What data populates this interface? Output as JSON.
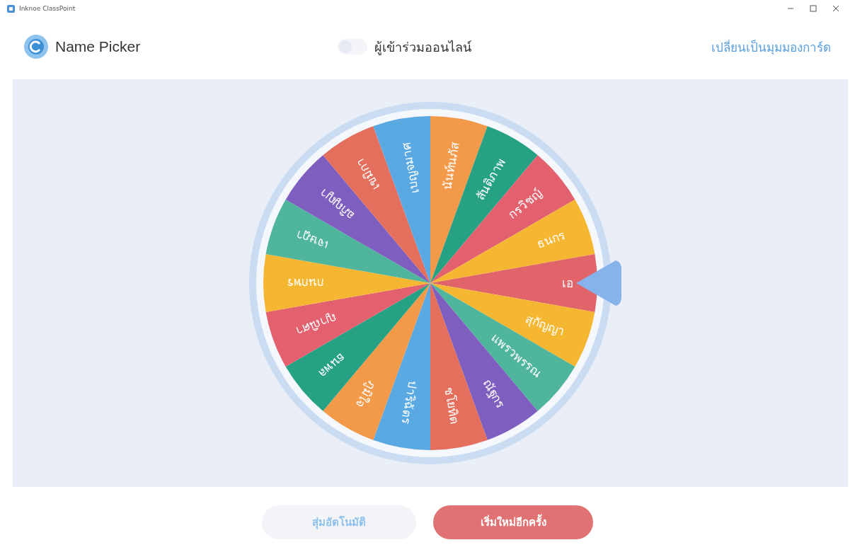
{
  "window": {
    "title": "Inknoe ClassPoint"
  },
  "header": {
    "title": "Name Picker",
    "toggle": {
      "label": "ผู้เข้าร่วมออนไลน์",
      "on": false
    },
    "link": "เปลี่ยนเป็นมุมมองการ์ด"
  },
  "wheel": {
    "segments": [
      {
        "name": "นันท์นภัส",
        "color": "#f2994a"
      },
      {
        "name": "สันติภาพ",
        "color": "#26a184"
      },
      {
        "name": "กรวิชญ์",
        "color": "#e3606f"
      },
      {
        "name": "ธนกร",
        "color": "#f5b731"
      },
      {
        "name": "เอ",
        "color": "#e2646b"
      },
      {
        "name": "สุกัญญา",
        "color": "#f5b731"
      },
      {
        "name": "แพรวพรรณ",
        "color": "#4fb59d"
      },
      {
        "name": "ณัฐกร",
        "color": "#7e5ebf"
      },
      {
        "name": "ชโยทิต",
        "color": "#e36f5c"
      },
      {
        "name": "ปาริฉัตร",
        "color": "#5aa9e2"
      },
      {
        "name": "ภูมิใจ",
        "color": "#f2994a"
      },
      {
        "name": "ธนพล",
        "color": "#26a184"
      },
      {
        "name": "ญาณิศา",
        "color": "#e3606f"
      },
      {
        "name": "กนกพร",
        "color": "#f5b731"
      },
      {
        "name": "เจษฎา",
        "color": "#4fb59d"
      },
      {
        "name": "อภิญญา",
        "color": "#7e5ebf"
      },
      {
        "name": "เขมิกา",
        "color": "#e36f5c"
      },
      {
        "name": "เบญจมาศ",
        "color": "#5aa9e2"
      }
    ]
  },
  "buttons": [
    {
      "label": "สุ่มอัตโนมัติ",
      "kind": "secondary"
    },
    {
      "label": "เริ่มใหม่อีกครั้ง",
      "kind": "primary"
    }
  ]
}
